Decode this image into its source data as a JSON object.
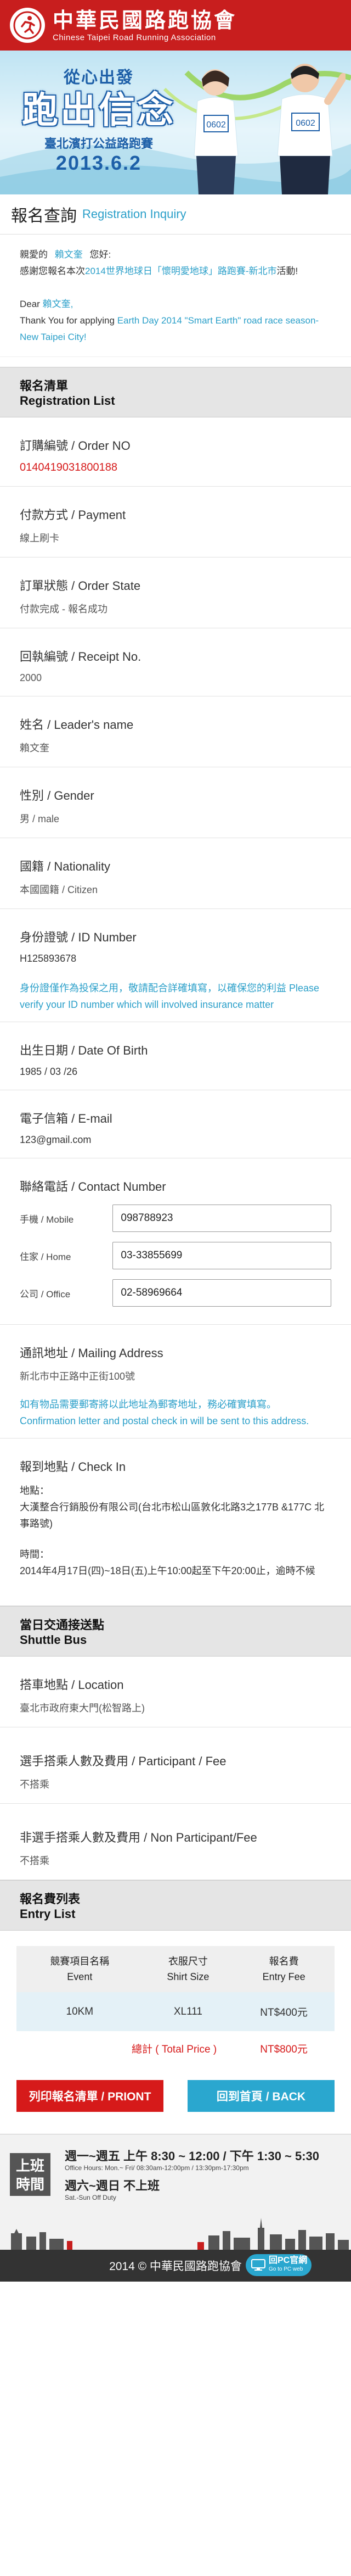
{
  "header": {
    "title": "中華民國路跑協會",
    "subtitle": "Chinese Taipei Road Running Association"
  },
  "banner": {
    "line1": "從心出發",
    "line2": "跑出信念",
    "line3": "臺北濱打公益路跑賽",
    "line4": "2013.6.2",
    "bib1": "0602",
    "bib2": "0602"
  },
  "page": {
    "title_zh": "報名查詢",
    "title_en": "Registration Inquiry"
  },
  "intro": {
    "zh_greeting_prefix": "親愛的",
    "zh_name": "賴文奎",
    "zh_greeting_suffix": "您好:",
    "zh_body_prefix": "感謝您報名本次",
    "zh_event": "2014世界地球日「懷明愛地球」路跑賽-新北市",
    "zh_body_suffix": "活動!",
    "en_dear": "Dear",
    "en_name": "賴文奎,",
    "en_thanks": "Thank You for applying",
    "en_event": "Earth Day 2014 \"Smart Earth\" road race season-New Taipei City!"
  },
  "registration": {
    "head_zh": "報名清單",
    "head_en": "Registration List",
    "order_no_label": "訂購編號 / Order NO",
    "order_no": "0140419031800188",
    "payment_label": "付款方式 / Payment",
    "payment": "線上刷卡",
    "order_state_label": "訂單狀態 / Order State",
    "order_state": "付款完成 - 報名成功",
    "receipt_label": "回執編號 / Receipt No.",
    "receipt": "2000",
    "leader_label": "姓名 / Leader's name",
    "leader": "賴文奎",
    "gender_label": "性別 / Gender",
    "gender": "男 / male",
    "nationality_label": "國籍 / Nationality",
    "nationality": "本國國籍 / Citizen",
    "id_label": "身份證號 / ID Number",
    "id": "H125893678",
    "id_note": "身份證僅作為投保之用，敬請配合詳確填寫，以確保您的利益 Please verify your ID number which will involved insurance matter",
    "dob_label": "出生日期 / Date Of Birth",
    "dob": "1985 / 03 /26",
    "email_label": "電子信箱 / E-mail",
    "email": "123@gmail.com",
    "contact_label": "聯絡電話 / Contact Number",
    "mobile_label": "手機 / Mobile",
    "mobile": "098788923",
    "home_label": "住家 / Home",
    "home": "03-33855699",
    "office_label": "公司 / Office",
    "office": "02-58969664",
    "mailing_label": "通訊地址 / Mailing Address",
    "mailing": "新北市中正路中正街100號",
    "mailing_note": "如有物品需要郵寄將以此地址為郵寄地址，務必確實填寫。Confirmation letter and postal check in will be sent to this address.",
    "checkin_label": "報到地點 / Check In",
    "checkin_addr_label": "地點：",
    "checkin_addr": "大漢整合行銷股份有限公司(台北市松山區敦化北路3之177B &177C 北事路號)",
    "checkin_time_label": "時間：",
    "checkin_time": "2014年4月17日(四)~18日(五)上午10:00起至下午20:00止，逾時不候"
  },
  "shuttle": {
    "head_zh": "當日交通接送點",
    "head_en": "Shuttle Bus",
    "location_label": "搭車地點 / Location",
    "location": "臺北市政府東大門(松智路上)",
    "participant_label": "選手搭乘人數及費用 / Participant / Fee",
    "participant": "不搭乘",
    "non_participant_label": "非選手搭乘人數及費用 / Non Participant/Fee",
    "non_participant": "不搭乘"
  },
  "fee_list": {
    "head_zh": "報名費列表",
    "head_en": "Entry List",
    "columns": [
      {
        "zh": "競賽項目名稱",
        "en": "Event"
      },
      {
        "zh": "衣服尺寸",
        "en": "Shirt Size"
      },
      {
        "zh": "報名費",
        "en": "Entry Fee"
      }
    ],
    "rows": [
      {
        "event": "10KM",
        "size": "XL111",
        "fee": "NT$400元"
      }
    ],
    "total_label": "總計 ( Total Price )",
    "total": "NT$800元"
  },
  "actions": {
    "print": "列印報名清單 / PRIONT",
    "back": "回到首頁 / BACK"
  },
  "footer": {
    "hours_badge": "上班時間",
    "line1": "週一~週五 上午 8:30 ~ 12:00 / 下午 1:30 ~ 5:30",
    "line1_sub": "Office Hours: Mon.~ Fri/ 08:30am-12:00pm / 13:30pm-17:30pm",
    "line2": "週六~週日 不上班",
    "line2_sub": "Sat.-Sun Off Duty",
    "copyright": "2014 © 中華民國路跑協會",
    "pc_label": "回PC官網",
    "pc_sub": "Go to PC web"
  },
  "colors": {
    "brand_red": "#c81e1e",
    "accent_blue": "#2a9fc9",
    "value_red": "#d61a1a"
  }
}
